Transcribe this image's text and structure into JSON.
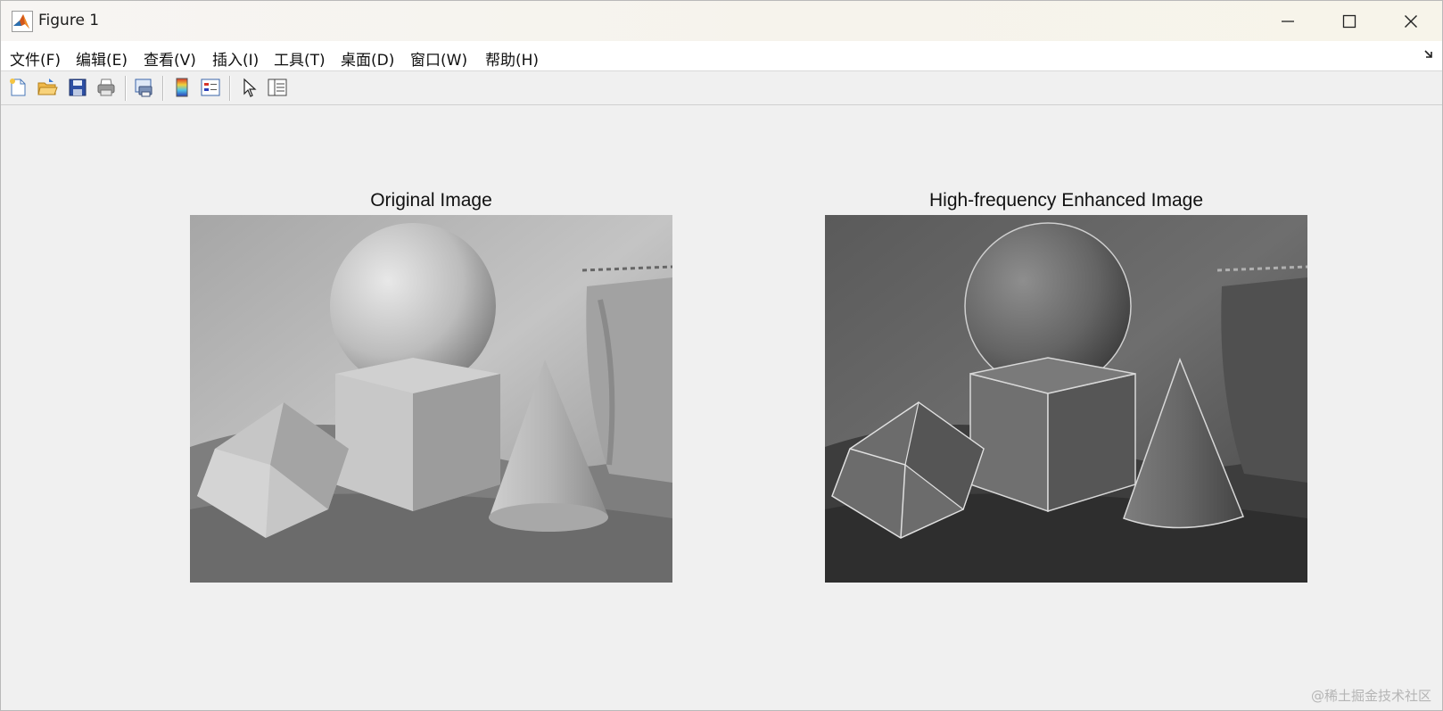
{
  "window": {
    "title": "Figure 1"
  },
  "menu": [
    "文件(F)",
    "编辑(E)",
    "查看(V)",
    "插入(I)",
    "工具(T)",
    "桌面(D)",
    "窗口(W)",
    "帮助(H)"
  ],
  "toolbar_icons": [
    "new-figure-icon",
    "open-folder-icon",
    "save-icon",
    "print-icon",
    "print-preview-icon",
    "colorbar-icon",
    "legend-icon",
    "pointer-icon",
    "property-inspector-icon"
  ],
  "axes": [
    {
      "title": "Original Image"
    },
    {
      "title": "High-frequency Enhanced Image"
    }
  ],
  "watermark": "@稀土掘金技术社区"
}
